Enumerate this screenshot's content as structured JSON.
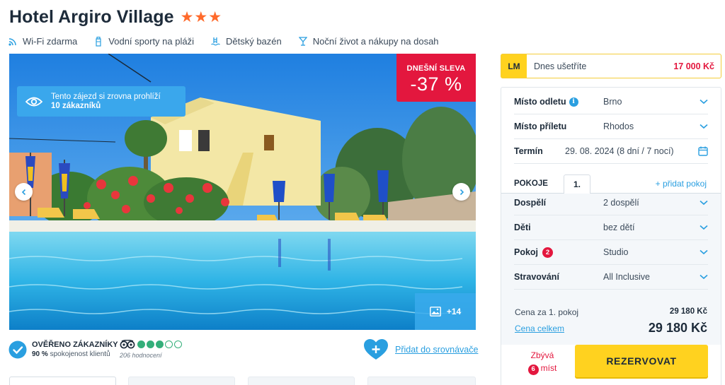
{
  "hotel": {
    "name": "Hotel Argiro Village",
    "stars": "★★★"
  },
  "amenities": [
    {
      "icon": "wifi-icon",
      "label": "Wi-Fi zdarma"
    },
    {
      "icon": "bottle-icon",
      "label": "Vodní sporty na pláži"
    },
    {
      "icon": "pool-ladder-icon",
      "label": "Dětský bazén"
    },
    {
      "icon": "cocktail-icon",
      "label": "Noční život a nákupy na dosah"
    }
  ],
  "gallery": {
    "viewers_line1": "Tento zájezd si zrovna prohlíží",
    "viewers_line2": "10 zákazníků",
    "sale_label": "DNEŠNÍ SLEVA",
    "sale_value": "-37 %",
    "photo_count": "+14"
  },
  "reviews": {
    "verified_title": "OVĚŘENO ZÁKAZNÍKY",
    "verified_pct": "90 %",
    "verified_text": "spokojenost klientů",
    "tripadvisor_rating": 3,
    "tripadvisor_max": 5,
    "tripadvisor_count": "206 hodnocení",
    "compare_label": "Přidat do srovnávače"
  },
  "lastminute": {
    "tag": "LM",
    "label": "Dnes ušetříte",
    "value": "17 000 Kč"
  },
  "form": {
    "departure_label": "Místo odletu",
    "departure_value": "Brno",
    "arrival_label": "Místo příletu",
    "arrival_value": "Rhodos",
    "term_label": "Termín",
    "term_value": "29. 08. 2024 (8 dní / 7 nocí)",
    "rooms_label": "POKOJE",
    "room_tab": "1.",
    "add_room": "+ přidat pokoj",
    "adults_label": "Dospělí",
    "adults_value": "2 dospělí",
    "children_label": "Děti",
    "children_value": "bez dětí",
    "room_label": "Pokoj",
    "room_badge": "2",
    "room_value": "Studio",
    "board_label": "Stravování",
    "board_value": "All Inclusive"
  },
  "price": {
    "per_room_label": "Cena za 1. pokoj",
    "per_room_value": "29 180 Kč",
    "total_label": "Cena celkem",
    "total_value": "29 180 Kč"
  },
  "booking": {
    "remain_label": "Zbývá",
    "remain_count": "6",
    "remain_unit": "míst",
    "reserve_label": "REZERVOVAT"
  },
  "colors": {
    "accent_blue": "#2a9fe0",
    "sale_red": "#e3173e",
    "star_orange": "#ff6a2b",
    "reserve_yellow": "#ffd21f",
    "tripadvisor_green": "#34af7a"
  }
}
